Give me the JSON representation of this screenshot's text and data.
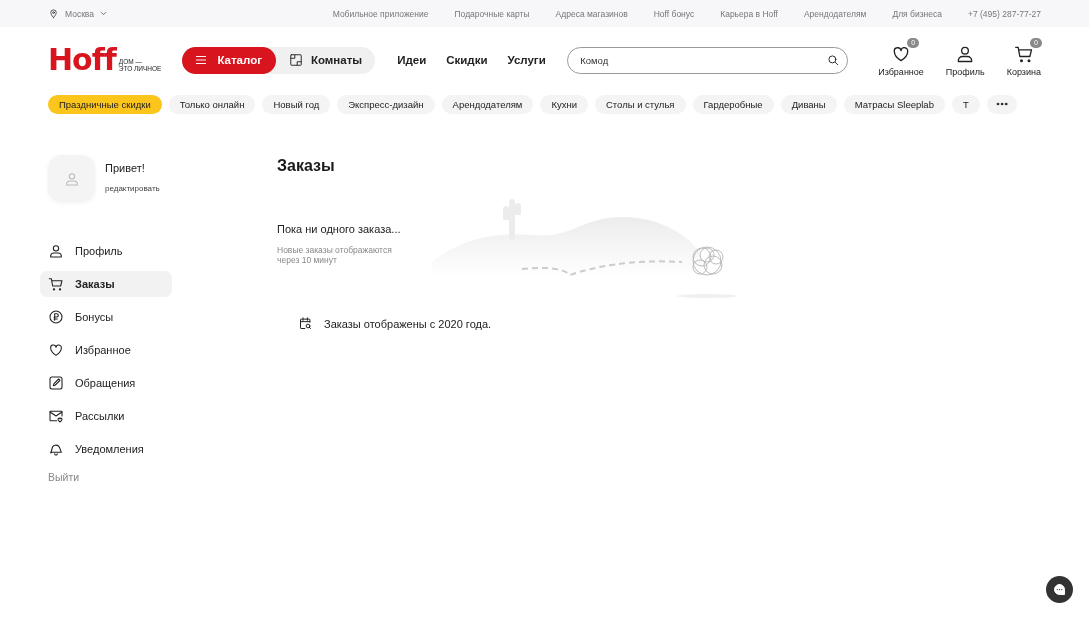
{
  "top_bar": {
    "city": "Москва",
    "links": [
      "Мобильное приложение",
      "Подарочные карты",
      "Адреса магазинов",
      "Hoff бонус",
      "Карьера в Hoff",
      "Арендодателям",
      "Для бизнеса"
    ],
    "phone": "+7 (495) 287-77-27"
  },
  "header": {
    "logo": {
      "wordmark": "Hoff",
      "tagline_1": "ДОМ —",
      "tagline_2": "ЭТО ЛИЧНОЕ"
    },
    "catalog_button": "Каталог",
    "rooms_button": "Комнаты",
    "nav": [
      "Идеи",
      "Скидки",
      "Услуги"
    ],
    "search": {
      "value": "Комод"
    },
    "actions": [
      {
        "kind": "favorites",
        "label": "Избранное",
        "badge": "0"
      },
      {
        "kind": "profile",
        "label": "Профиль"
      },
      {
        "kind": "cart",
        "label": "Корзина",
        "badge": "0"
      }
    ]
  },
  "chips": [
    {
      "label": "Праздничные скидки",
      "selected": true
    },
    {
      "label": "Только онлайн",
      "selected": false
    },
    {
      "label": "Новый год",
      "selected": false
    },
    {
      "label": "Экспресс-дизайн",
      "selected": false
    },
    {
      "label": "Арендодателям",
      "selected": false
    },
    {
      "label": "Кухни",
      "selected": false
    },
    {
      "label": "Столы и стулья",
      "selected": false
    },
    {
      "label": "Гардеробные",
      "selected": false
    },
    {
      "label": "Диваны",
      "selected": false
    },
    {
      "label": "Матрасы Sleeplab",
      "selected": false
    },
    {
      "label": "Т",
      "selected": false
    }
  ],
  "sidebar": {
    "greeting": "Привет!",
    "edit_link": "редактировать",
    "items": [
      {
        "kind": "profile",
        "label": "Профиль",
        "selected": false
      },
      {
        "kind": "orders",
        "label": "Заказы",
        "selected": true
      },
      {
        "kind": "bonus",
        "label": "Бонусы",
        "selected": false
      },
      {
        "kind": "favorites",
        "label": "Избранное",
        "selected": false
      },
      {
        "kind": "requests",
        "label": "Обращения",
        "selected": false
      },
      {
        "kind": "mailings",
        "label": "Рассылки",
        "selected": false
      },
      {
        "kind": "notifications",
        "label": "Уведомления",
        "selected": false
      }
    ],
    "logout": "Выйти"
  },
  "main": {
    "title": "Заказы",
    "empty_title": "Пока ни одного заказа...",
    "empty_note": "Новые заказы отображаются через 10 минут",
    "info": "Заказы отображены с 2020 года."
  }
}
